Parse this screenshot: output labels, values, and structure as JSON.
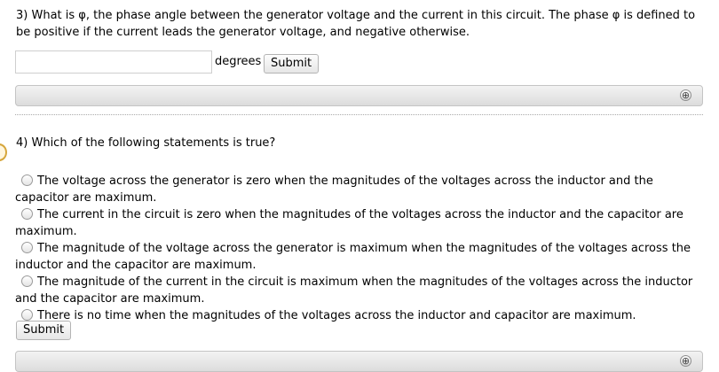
{
  "q3": {
    "text": "3) What is φ, the phase angle between the generator voltage and the current in this circuit. The phase φ is defined to be positive if the current leads the generator voltage, and negative otherwise.",
    "answer_value": "",
    "units_label": "degrees",
    "submit_label": "Submit",
    "expand_icon": "⊕"
  },
  "q4": {
    "text": "4) Which of the following statements is true?",
    "options": [
      "The voltage across the generator is zero when the magnitudes of the voltages across the inductor and the capacitor are maximum.",
      "The current in the circuit is zero when the magnitudes of the voltages across the inductor and the capacitor are maximum.",
      "The magnitude of the voltage across the generator is maximum when the magnitudes of the voltages across the inductor and the capacitor are maximum.",
      "The magnitude of the current in the circuit is maximum when the magnitudes of the voltages across the inductor and the capacitor are maximum.",
      "There is no time when the magnitudes of the voltages across the inductor and capacitor are maximum."
    ],
    "submit_label": "Submit",
    "expand_icon": "⊕"
  },
  "icons": {
    "side": "clock-icon",
    "expand": "plus-circle-icon",
    "radio": "radio-button-icon"
  },
  "colors": {
    "bar_top": "#f3f3f3",
    "bar_bottom": "#dcdcdc",
    "divider": "#a9a9a9"
  }
}
